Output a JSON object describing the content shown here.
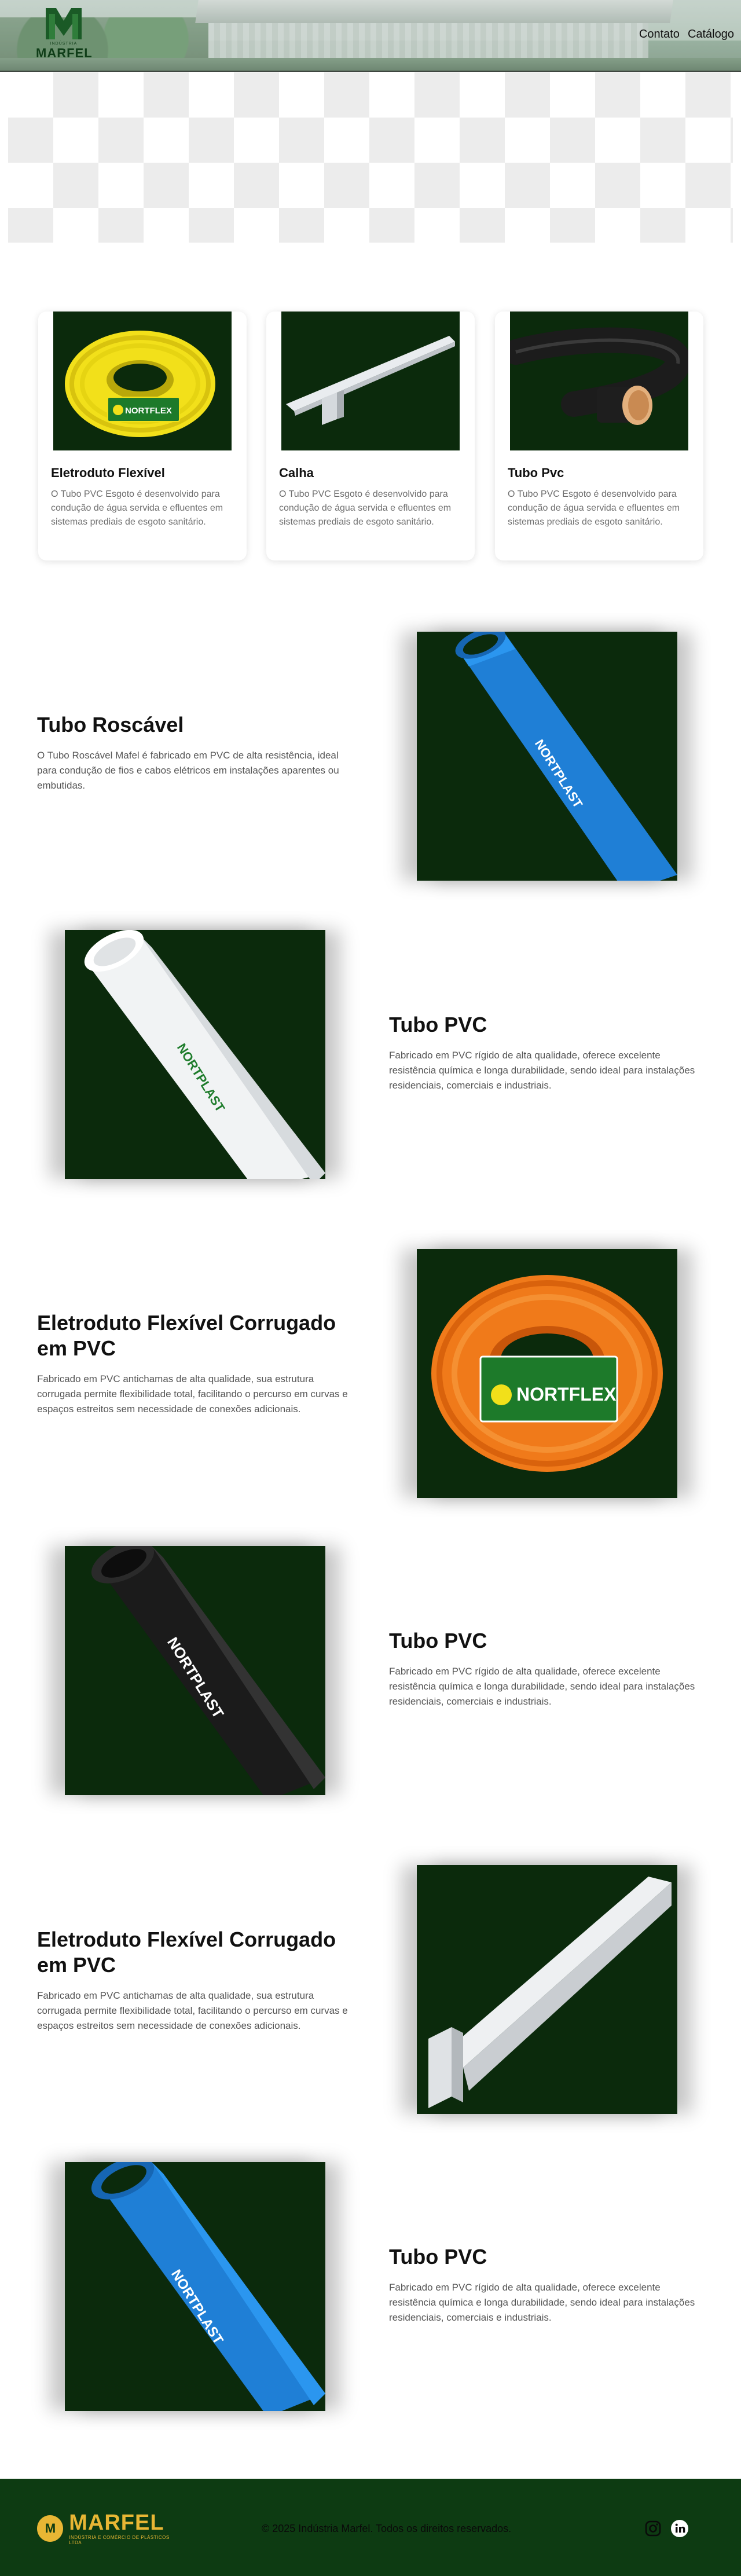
{
  "header": {
    "brand_word": "MARFEL",
    "brand_sub": "INDÚSTRIA",
    "nav": [
      {
        "label": "Contato"
      },
      {
        "label": "Catálogo"
      }
    ]
  },
  "cards": [
    {
      "title": "Eletroduto Flexível",
      "description": "O Tubo PVC Esgoto é desenvolvido para condução de água servida e efluentes em sistemas prediais de esgoto sanitário.",
      "image_brand": "NORTFLEX"
    },
    {
      "title": "Calha",
      "description": "O Tubo PVC Esgoto é desenvolvido para condução de água servida e efluentes em sistemas prediais de esgoto sanitário."
    },
    {
      "title": "Tubo Pvc",
      "description": "O Tubo PVC Esgoto é desenvolvido para condução de água servida e efluentes em sistemas prediais de esgoto sanitário."
    }
  ],
  "features": [
    {
      "title": "Tubo Roscável",
      "description": "O Tubo Roscável Mafel é fabricado em PVC de alta resistência, ideal para condução de fios e cabos elétricos em instalações aparentes ou embutidas.",
      "image_brand": "NORTPLAST"
    },
    {
      "title": "Tubo PVC",
      "description": "Fabricado em PVC rígido de alta qualidade, oferece excelente resistência química e longa durabilidade, sendo ideal para instalações residenciais, comerciais e industriais.",
      "image_brand": "NORTPLAST"
    },
    {
      "title": "Eletroduto Flexível Corrugado em PVC",
      "description": "Fabricado em PVC antichamas de alta qualidade, sua estrutura corrugada permite flexibilidade total, facilitando o percurso em curvas e espaços estreitos sem necessidade de conexões adicionais.",
      "image_brand": "NORTFLEX"
    },
    {
      "title": "Tubo PVC",
      "description": "Fabricado em PVC rígido de alta qualidade, oferece excelente resistência química e longa durabilidade, sendo ideal para instalações residenciais, comerciais e industriais.",
      "image_brand": "NORTPLAST"
    },
    {
      "title": "Eletroduto Flexível Corrugado em PVC",
      "description": "Fabricado em PVC antichamas de alta qualidade, sua estrutura corrugada permite flexibilidade total, facilitando o percurso em curvas e espaços estreitos sem necessidade de conexões adicionais."
    },
    {
      "title": "Tubo PVC",
      "description": "Fabricado em PVC rígido de alta qualidade, oferece excelente resistência química e longa durabilidade, sendo ideal para instalações residenciais, comerciais e industriais.",
      "image_brand": "NORTPLAST"
    }
  ],
  "footer": {
    "brand_word": "MARFEL",
    "brand_sub": "INDÚSTRIA E COMÉRCIO DE PLÁSTICOS LTDA",
    "copyright": "© 2025 Indústria Marfel. Todos os direitos reservados.",
    "social": [
      {
        "icon": "instagram-icon"
      },
      {
        "icon": "linkedin-icon"
      }
    ]
  },
  "colors": {
    "brand_green": "#0d3b12",
    "image_bg": "#0b2a0c",
    "brand_gold": "#e8b634"
  }
}
